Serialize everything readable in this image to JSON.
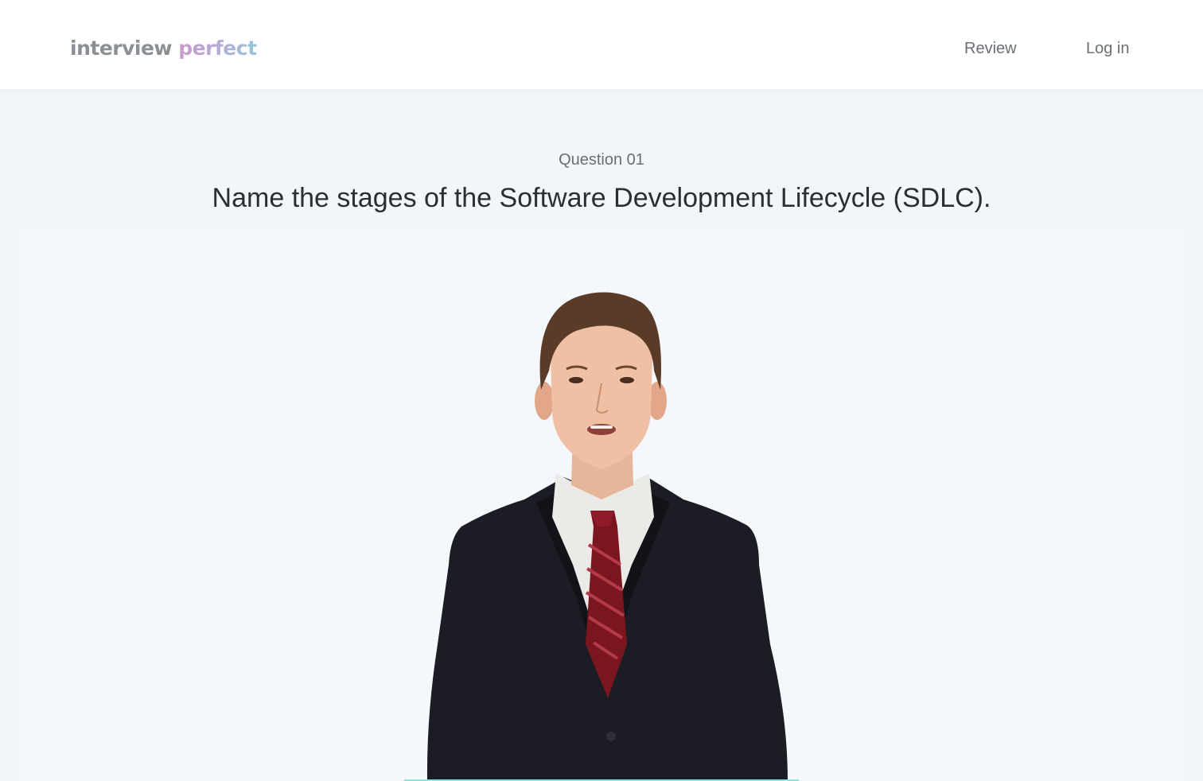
{
  "header": {
    "logo_part1": "interview ",
    "logo_part2": "perfect",
    "nav": {
      "review": "Review",
      "login": "Log in"
    }
  },
  "question": {
    "label": "Question 01",
    "text": "Name the stages of the Software Development Lifecycle (SDLC)."
  },
  "colors": {
    "page_background": "#f2f5f9",
    "nav_text": "#6b7076",
    "question_text": "#2b2f34",
    "logo_gray": "#8a9096",
    "logo_gradient_start": "#c79bcb",
    "logo_gradient_end": "#93c6d8",
    "progress_accent": "#8fe3e0"
  }
}
